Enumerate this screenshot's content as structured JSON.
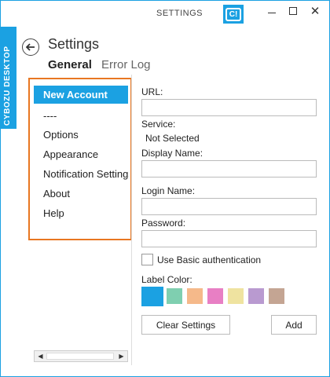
{
  "window": {
    "title": "SETTINGS",
    "logo_text": "C!",
    "close_glyph": "✕"
  },
  "side_tab": {
    "label": "CYBOZU DESKTOP"
  },
  "header": {
    "title": "Settings",
    "tabs": [
      {
        "label": "General",
        "active": true
      },
      {
        "label": "Error Log",
        "active": false
      }
    ]
  },
  "menu": {
    "items": [
      {
        "label": "New Account",
        "selected": true
      },
      {
        "label": "----"
      },
      {
        "label": "Options"
      },
      {
        "label": "Appearance"
      },
      {
        "label": "Notification Settings"
      },
      {
        "label": "About"
      },
      {
        "label": "Help"
      }
    ]
  },
  "form": {
    "url_label": "URL:",
    "url_value": "",
    "service_label": "Service:",
    "service_value": "Not Selected",
    "display_name_label": "Display Name:",
    "display_name_value": "",
    "login_name_label": "Login Name:",
    "login_name_value": "",
    "password_label": "Password:",
    "password_value": "",
    "basic_auth_label": "Use Basic authentication",
    "basic_auth_checked": false,
    "label_color_label": "Label Color:",
    "colors": [
      "#1ba1e2",
      "#7fcfb0",
      "#f5b98a",
      "#e87fc4",
      "#efe3a0",
      "#b99ad0",
      "#c4a593"
    ],
    "selected_color": "#1ba1e2",
    "clear_button": "Clear Settings",
    "add_button": "Add"
  },
  "accent_color": "#1ba1e2",
  "highlight_color": "#e87722"
}
